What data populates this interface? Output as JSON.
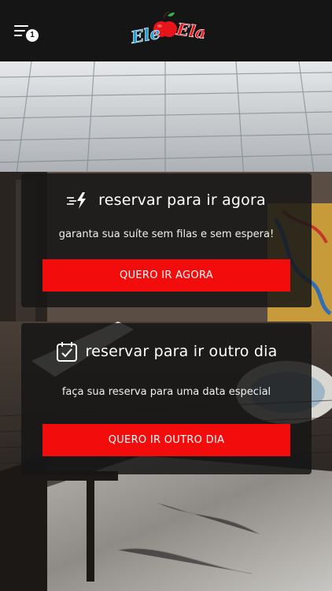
{
  "header": {
    "menu_badge_count": "1",
    "logo_text_left": "Ele",
    "logo_text_right": "Ela",
    "logo_icon": "apple-icon"
  },
  "cards": [
    {
      "icon": "fast-lightning-icon",
      "title": "reservar para ir agora",
      "subtitle": "garanta sua suíte sem filas e sem espera!",
      "button_label": "QUERO IR AGORA"
    },
    {
      "icon": "calendar-check-icon",
      "title": "reservar para ir outro dia",
      "subtitle": "faça sua reserva para uma data especial",
      "button_label": "QUERO IR OUTRO DIA"
    }
  ],
  "colors": {
    "accent": "#f20c0c",
    "header_bg": "#151515",
    "logo_blue": "#1aa0d8",
    "logo_red": "#e8141c"
  }
}
